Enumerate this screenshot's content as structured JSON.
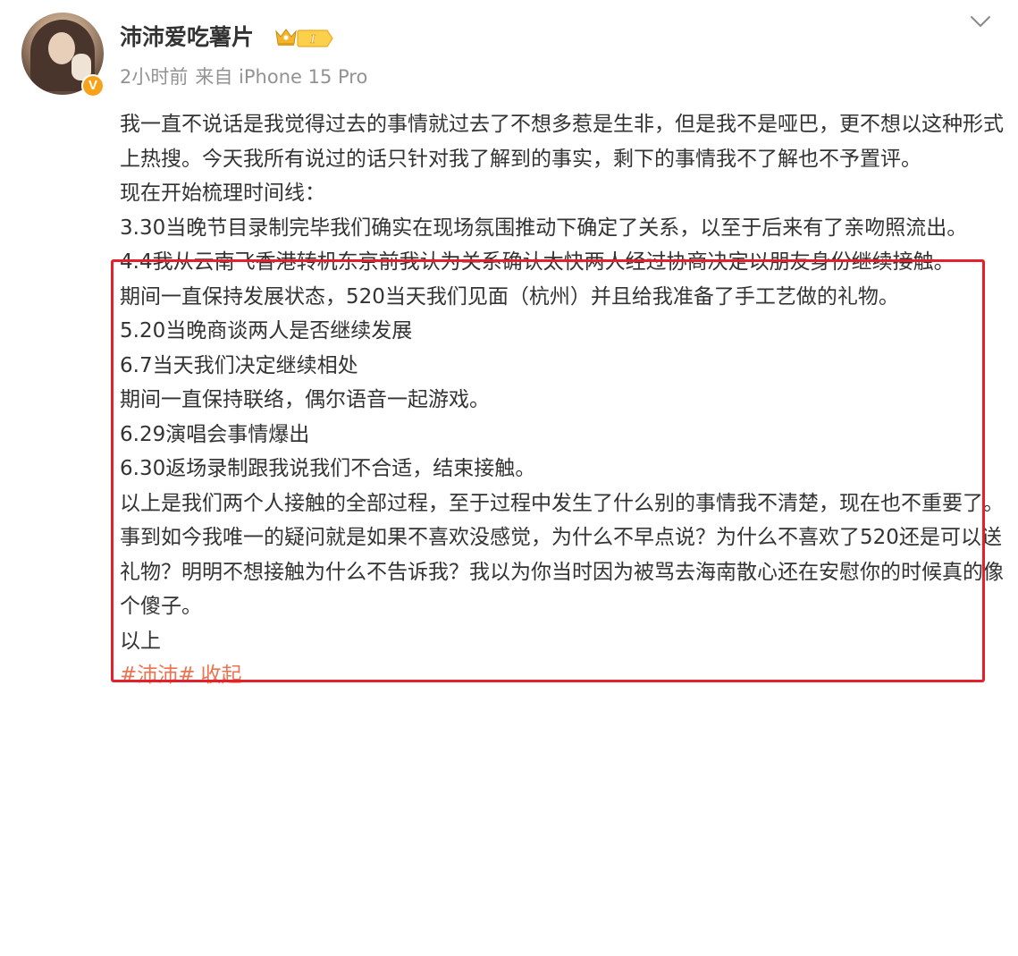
{
  "post": {
    "username": "沛沛爱吃薯片",
    "time": "2小时前",
    "source": "来自 iPhone 15 Pro",
    "verify_mark": "V",
    "level_mark": "I",
    "paragraphs_before": [
      "我一直不说话是我觉得过去的事情就过去了不想多惹是生非，但是我不是哑巴，更不想以这种形式上热搜。今天我所有说过的话只针对我了解到的事实，剩下的事情我不了解也不予置评。",
      "现在开始梳理时间线："
    ],
    "timeline": [
      "3.30当晚节目录制完毕我们确实在现场氛围推动下确定了关系，以至于后来有了亲吻照流出。",
      "4.4我从云南飞香港转机东京前我认为关系确认太快两人经过协商决定以朋友身份继续接触。",
      "期间一直保持发展状态，520当天我们见面（杭州）并且给我准备了手工艺做的礼物。",
      "5.20当晚商谈两人是否继续发展",
      "6.7当天我们决定继续相处",
      "期间一直保持联络，偶尔语音一起游戏。",
      "6.29演唱会事情爆出",
      "6.30返场录制跟我说我们不合适，结束接触。"
    ],
    "paragraphs_after": [
      "以上是我们两个人接触的全部过程，至于过程中发生了什么别的事情我不清楚，现在也不重要了。",
      "事到如今我唯一的疑问就是如果不喜欢没感觉，为什么不早点说？为什么不喜欢了520还是可以送礼物？明明不想接触为什么不告诉我？我以为你当时因为被骂去海南散心还在安慰你的时候真的像个傻子。",
      "以上"
    ],
    "hashtag": "#沛沛#",
    "collapse_label": "收起"
  },
  "colors": {
    "link": "#eb7350",
    "highlight_border": "#e5202b",
    "meta_text": "#939393",
    "body_text": "#333333",
    "verify_badge": "#f7a21b"
  },
  "icons": {
    "crown": "crown-icon",
    "level": "level-badge-icon",
    "more": "chevron-down-icon",
    "verify": "verified-badge-icon"
  }
}
